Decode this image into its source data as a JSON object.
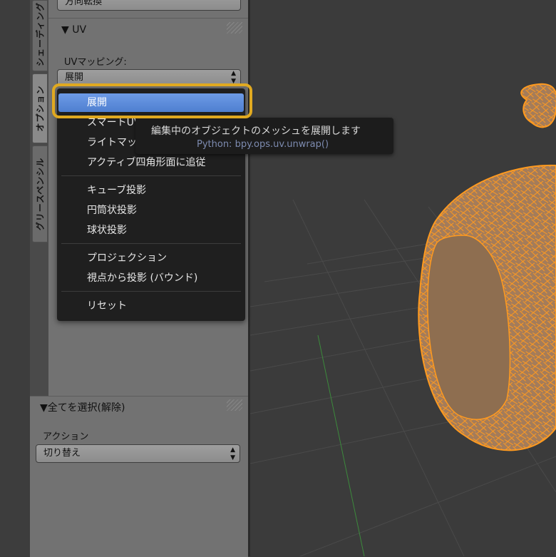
{
  "tabs": [
    {
      "label": "シェーディング"
    },
    {
      "label": "オプション"
    },
    {
      "label": "グリースペンシル"
    }
  ],
  "top_button": {
    "label": "方向転換"
  },
  "uv_panel": {
    "header": "▼ UV",
    "mapping_label": "UVマッピング:",
    "mapping_value": "展開"
  },
  "uv_menu": {
    "items": [
      {
        "label": "展開",
        "selected": true
      },
      {
        "label": "スマートUV投影"
      },
      {
        "label": "ライトマップパック"
      },
      {
        "label": "アクティブ四角形面に追従"
      },
      {
        "label": "キューブ投影"
      },
      {
        "label": "円筒状投影"
      },
      {
        "label": "球状投影"
      },
      {
        "label": "プロジェクション"
      },
      {
        "label": "視点から投影 (バウンド)"
      },
      {
        "label": "リセット"
      }
    ]
  },
  "tooltip": {
    "description": "編集中のオブジェクトのメッシュを展開します",
    "python": "Python: bpy.ops.uv.unwrap()"
  },
  "select_panel": {
    "header": "▼全てを選択(解除)",
    "action_label": "アクション",
    "action_value": "切り替え"
  },
  "colors": {
    "highlight": "#e0a920",
    "selected_item": "#5b8cdc",
    "wire": "#ff9a1f"
  },
  "icons": {
    "dropdown": "up-down-arrows-icon"
  }
}
